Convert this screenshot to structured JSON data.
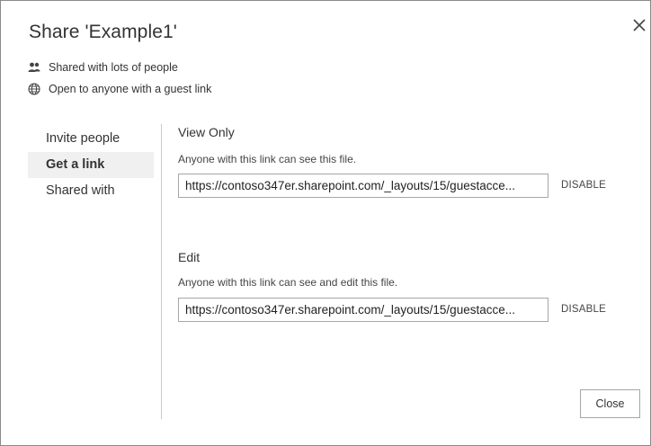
{
  "dialog": {
    "title": "Share 'Example1'",
    "close_icon": "close-icon"
  },
  "status": {
    "shared_text": "Shared with lots of people",
    "shared_icon": "people-icon",
    "guest_text": "Open to anyone with a guest link",
    "guest_icon": "globe-icon"
  },
  "nav": {
    "items": [
      {
        "label": "Invite people",
        "selected": false
      },
      {
        "label": "Get a link",
        "selected": true
      },
      {
        "label": "Shared with",
        "selected": false
      }
    ]
  },
  "view_only": {
    "title": "View Only",
    "description": "Anyone with this link can see this file.",
    "link": "https://contoso347er.sharepoint.com/_layouts/15/guestacce...",
    "disable_label": "DISABLE"
  },
  "edit": {
    "title": "Edit",
    "description": "Anyone with this link can see and edit this file.",
    "link": "https://contoso347er.sharepoint.com/_layouts/15/guestacce...",
    "disable_label": "DISABLE"
  },
  "footer": {
    "close_label": "Close"
  }
}
